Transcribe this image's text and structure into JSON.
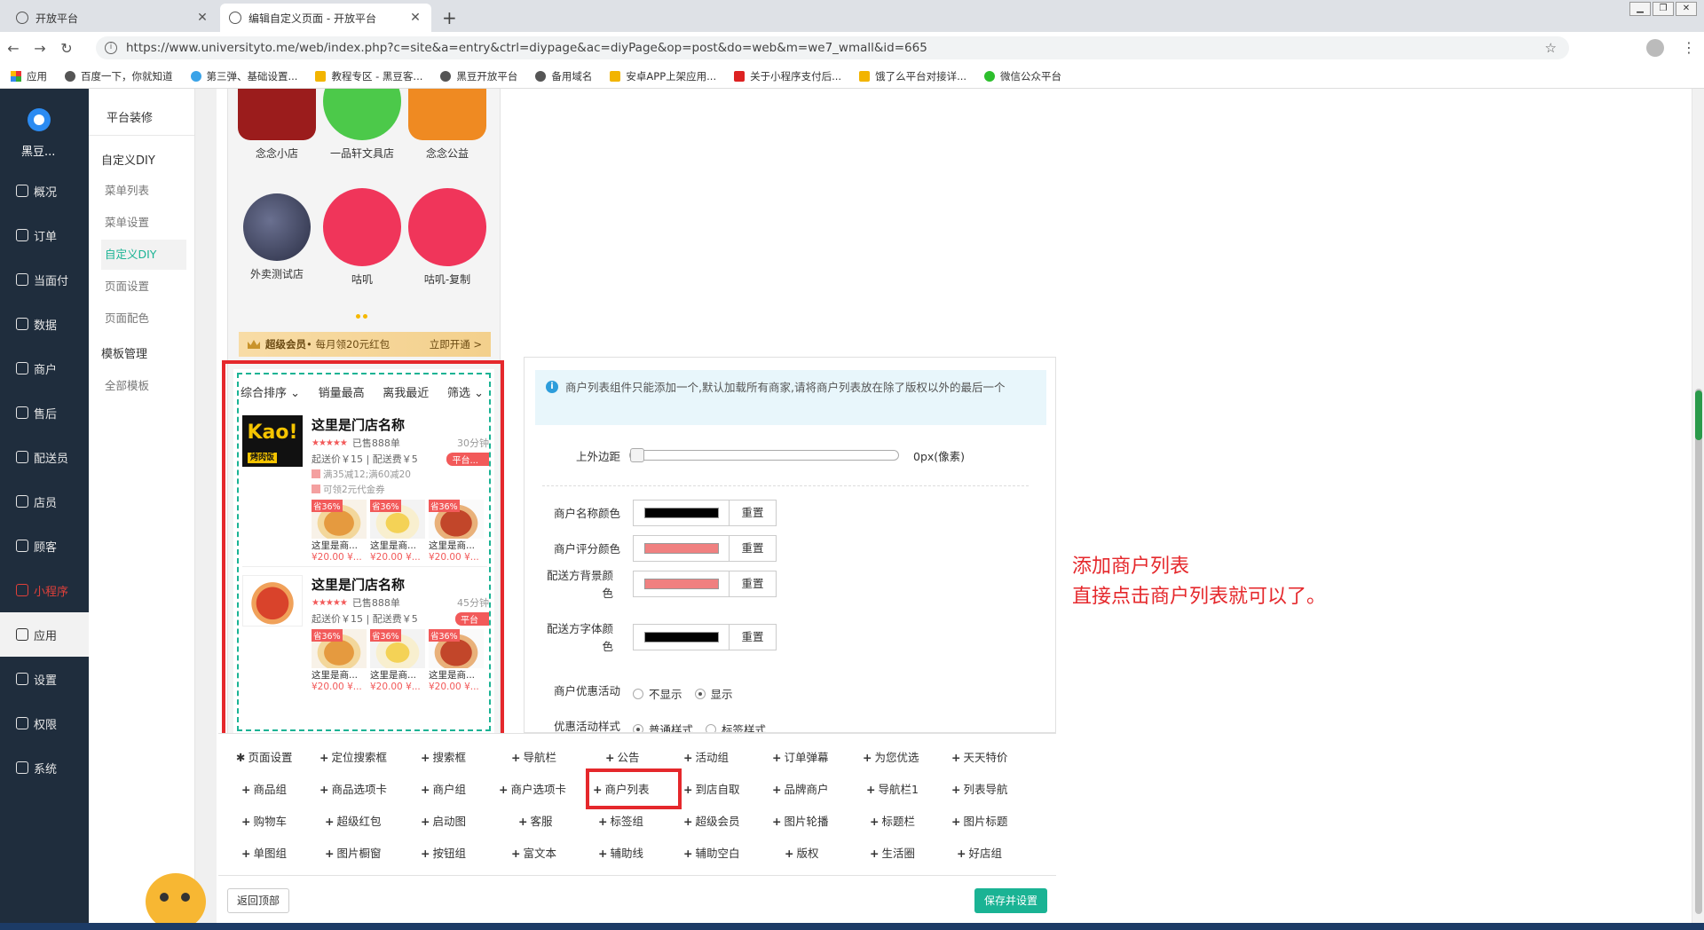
{
  "browser": {
    "tabs": [
      {
        "title": "开放平台",
        "active": false
      },
      {
        "title": "编辑自定义页面 - 开放平台",
        "active": true
      }
    ],
    "url": "https://www.universityto.me/web/index.php?c=site&a=entry&ctrl=diypage&ac=diyPage&op=post&do=web&m=we7_wmall&id=665",
    "bookmarks": [
      "应用",
      "百度一下，你就知道",
      "第三弹、基础设置...",
      "教程专区 - 黑豆客...",
      "黑豆开放平台",
      "备用域名",
      "安卓APP上架应用...",
      "关于小程序支付后...",
      "饿了么平台对接详...",
      "微信公众平台"
    ]
  },
  "app": {
    "brand": "黑豆...",
    "main_nav": [
      "概况",
      "订单",
      "当面付",
      "数据",
      "商户",
      "售后",
      "配送员",
      "店员",
      "顾客",
      "小程序",
      "应用",
      "设置",
      "权限",
      "系统"
    ],
    "active_main": "应用",
    "sub_nav": {
      "header": "平台装修",
      "groups": [
        {
          "title": "自定义DIY",
          "items": [
            "菜单列表",
            "菜单设置",
            "自定义DIY",
            "页面设置",
            "页面配色"
          ]
        },
        {
          "title": "模板管理",
          "items": [
            "全部模板"
          ]
        }
      ],
      "active": "自定义DIY"
    }
  },
  "preview": {
    "shop_icons": [
      {
        "name": "念念小店",
        "color": "#9b1c1c"
      },
      {
        "name": "一品轩文具店",
        "color": "#4cc94a"
      },
      {
        "name": "念念公益",
        "color": "#ef8a22"
      },
      {
        "name": "外卖测试店",
        "color": "#444a66"
      },
      {
        "name": "咕叽",
        "color": "#f0355a"
      },
      {
        "name": "咕叽-复制",
        "color": "#f0355a"
      }
    ],
    "vip_bar": {
      "title": "超级会员",
      "subtitle": "• 每月领20元红包",
      "action": "立即开通 >"
    },
    "sort_tabs": [
      "综合排序 ⌄",
      "销量最高",
      "离我最近",
      "筛选 ⌄"
    ],
    "shops": [
      {
        "name": "这里是门店名称",
        "sold": "已售888单",
        "time": "30分钟",
        "fee": "起送价￥15 | 配送费￥5",
        "tag": "平台...",
        "promo1": "满35减12;满60减20",
        "promo2": "可领2元代金券",
        "foods": [
          {
            "badge": "省36%",
            "name": "这里是商...",
            "price": "¥20.00 ¥..."
          },
          {
            "badge": "省36%",
            "name": "这里是商...",
            "price": "¥20.00 ¥..."
          },
          {
            "badge": "省36%",
            "name": "这里是商...",
            "price": "¥20.00 ¥..."
          }
        ]
      },
      {
        "name": "这里是门店名称",
        "sold": "已售888单",
        "time": "45分钟",
        "fee": "起送价￥15 | 配送费￥5",
        "tag": "平台",
        "foods": [
          {
            "badge": "省36%",
            "name": "这里是商...",
            "price": "¥20.00 ¥..."
          },
          {
            "badge": "省36%",
            "name": "这里是商...",
            "price": "¥20.00 ¥..."
          },
          {
            "badge": "省36%",
            "name": "这里是商...",
            "price": "¥20.00 ¥..."
          }
        ]
      }
    ],
    "logo_text": {
      "kao": "Kao!",
      "kao_sub": "烤肉饭"
    }
  },
  "settings": {
    "notice": "商户列表组件只能添加一个,默认加载所有商家,请将商户列表放在除了版权以外的最后一个",
    "margin_label": "上外边距",
    "margin_value": "0px(像素)",
    "color_fields": [
      {
        "label": "商户名称颜色",
        "color": "#000000",
        "reset": "重置"
      },
      {
        "label": "商户评分颜色",
        "color": "#f08080",
        "reset": "重置"
      },
      {
        "label": "配送方背景颜色",
        "color": "#f08080",
        "reset": "重置"
      },
      {
        "label": "配送方字体颜色",
        "color": "#000000",
        "reset": "重置"
      }
    ],
    "promo_label": "商户优惠活动",
    "promo_options": [
      "不显示",
      "显示"
    ],
    "promo_selected": "显示",
    "style_label": "优惠活动样式",
    "style_options": [
      "普通样式",
      "标签样式"
    ],
    "style_selected": "普通样式"
  },
  "palette": {
    "items": [
      [
        "页面设置",
        "定位搜索框",
        "搜索框",
        "导航栏",
        "公告",
        "活动组",
        "订单弹幕",
        "为您优选",
        "天天特价"
      ],
      [
        "商品组",
        "商品选项卡",
        "商户组",
        "商户选项卡",
        "商户列表",
        "到店自取",
        "品牌商户",
        "导航栏1",
        "列表导航"
      ],
      [
        "购物车",
        "超级红包",
        "启动图",
        "客服",
        "标签组",
        "超级会员",
        "图片轮播",
        "标题栏",
        "图片标题"
      ],
      [
        "单图组",
        "图片橱窗",
        "按钮组",
        "富文本",
        "辅助线",
        "辅助空白",
        "版权",
        "生活圈",
        "好店组"
      ]
    ],
    "highlighted": "商户列表"
  },
  "footer": {
    "back_top": "返回顶部",
    "save": "保存并设置"
  },
  "annotation": {
    "line1": "添加商户列表",
    "line2": "直接点击商户列表就可以了。"
  },
  "colors": {
    "accent": "#1ab394",
    "highlight_red": "#e5282c",
    "sidebar": "#1f2d3d"
  }
}
